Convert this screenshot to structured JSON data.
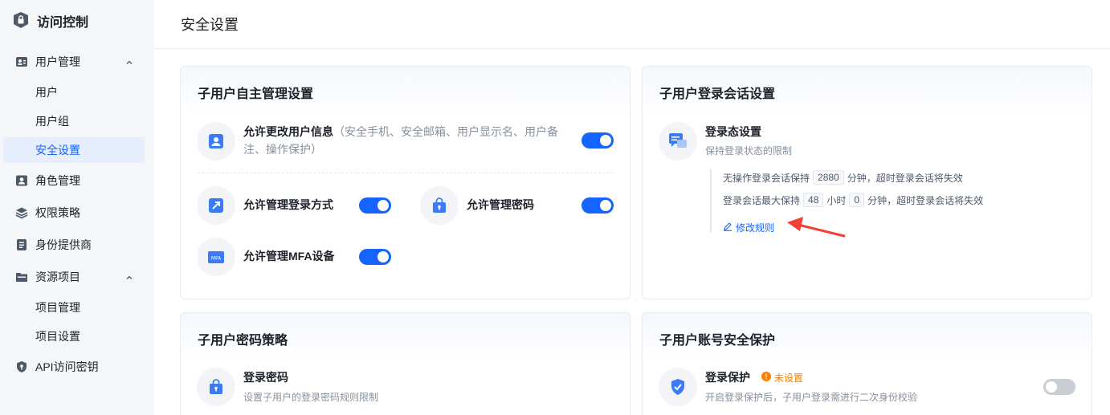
{
  "app": {
    "title": "访问控制"
  },
  "sidebar": {
    "items": [
      {
        "label": "用户管理"
      },
      {
        "label": "用户"
      },
      {
        "label": "用户组"
      },
      {
        "label": "安全设置"
      },
      {
        "label": "角色管理"
      },
      {
        "label": "权限策略"
      },
      {
        "label": "身份提供商"
      },
      {
        "label": "资源项目"
      },
      {
        "label": "项目管理"
      },
      {
        "label": "项目设置"
      },
      {
        "label": "API访问密钥"
      }
    ]
  },
  "page": {
    "title": "安全设置"
  },
  "self_manage": {
    "title": "子用户自主管理设置",
    "change_info": {
      "label": "允许更改用户信息",
      "detail": "（安全手机、安全邮箱、用户显示名、用户备注、操作保护）",
      "enabled": true
    },
    "login_method": {
      "label": "允许管理登录方式",
      "enabled": true
    },
    "password": {
      "label": "允许管理密码",
      "enabled": true
    },
    "mfa": {
      "label": "允许管理MFA设备",
      "icon_text": "MFA",
      "enabled": true
    }
  },
  "session": {
    "title": "子用户登录会话设置",
    "login_state": {
      "title": "登录态设置",
      "desc": "保持登录状态的限制"
    },
    "rule1": {
      "prefix": "无操作登录会话保持",
      "value": "2880",
      "suffix": "分钟，超时登录会话将失效"
    },
    "rule2": {
      "prefix": "登录会话最大保持",
      "hours": "48",
      "hours_unit": "小时",
      "minutes": "0",
      "suffix": "分钟，超时登录会话将失效"
    },
    "edit_label": "修改规则"
  },
  "password_policy": {
    "title": "子用户密码策略",
    "login_password": {
      "title": "登录密码",
      "desc": "设置子用户的登录密码规则限制"
    }
  },
  "account_protect": {
    "title": "子用户账号安全保护",
    "login_protect": {
      "title": "登录保护",
      "status": "未设置",
      "desc": "开启登录保护后，子用户登录需进行二次身份校验",
      "enabled": false
    }
  },
  "colors": {
    "accent": "#1664ff",
    "warning": "#ff7d00",
    "annotation": "#f04134"
  }
}
